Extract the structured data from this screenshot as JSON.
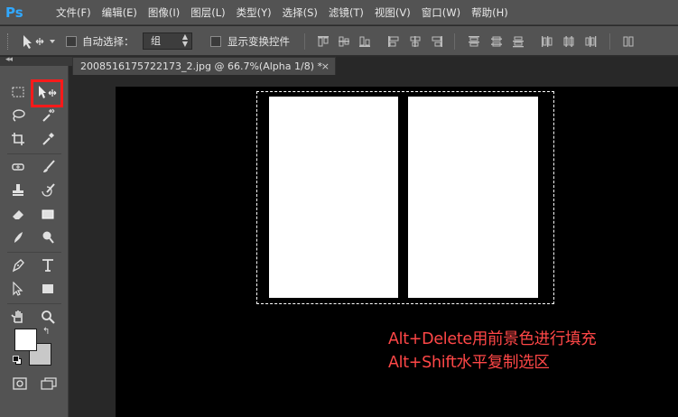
{
  "app": {
    "logo_text": "Ps",
    "accent": "#31a8ff"
  },
  "menu": {
    "items": [
      {
        "id": "file",
        "label": "文件(F)"
      },
      {
        "id": "edit",
        "label": "编辑(E)"
      },
      {
        "id": "image",
        "label": "图像(I)"
      },
      {
        "id": "layer",
        "label": "图层(L)"
      },
      {
        "id": "type",
        "label": "类型(Y)"
      },
      {
        "id": "select",
        "label": "选择(S)"
      },
      {
        "id": "filter",
        "label": "滤镜(T)"
      },
      {
        "id": "view",
        "label": "视图(V)"
      },
      {
        "id": "window",
        "label": "窗口(W)"
      },
      {
        "id": "help",
        "label": "帮助(H)"
      }
    ]
  },
  "options": {
    "auto_select_label": "自动选择：",
    "auto_select_checked": false,
    "auto_select_value": "组",
    "show_transform_label": "显示变换控件",
    "show_transform_checked": false
  },
  "document": {
    "tab_title": "2008516175722173_2.jpg @ 66.7%(Alpha 1/8) *",
    "close_glyph": "×"
  },
  "toolbox": {
    "collapse_glyph": "◂◂",
    "active_tool": "move-tool",
    "highlight_color": "#ff1a1a",
    "foreground_color": "#ffffff",
    "background_color": "#c8c8c8"
  },
  "canvas": {
    "background": "#000000",
    "panel_color": "#ffffff",
    "selection": "marching-ants"
  },
  "annotation": {
    "color": "#ff4747",
    "lines": [
      "Alt+Delete用前景色进行填充",
      "Alt+Shift水平复制选区"
    ]
  }
}
